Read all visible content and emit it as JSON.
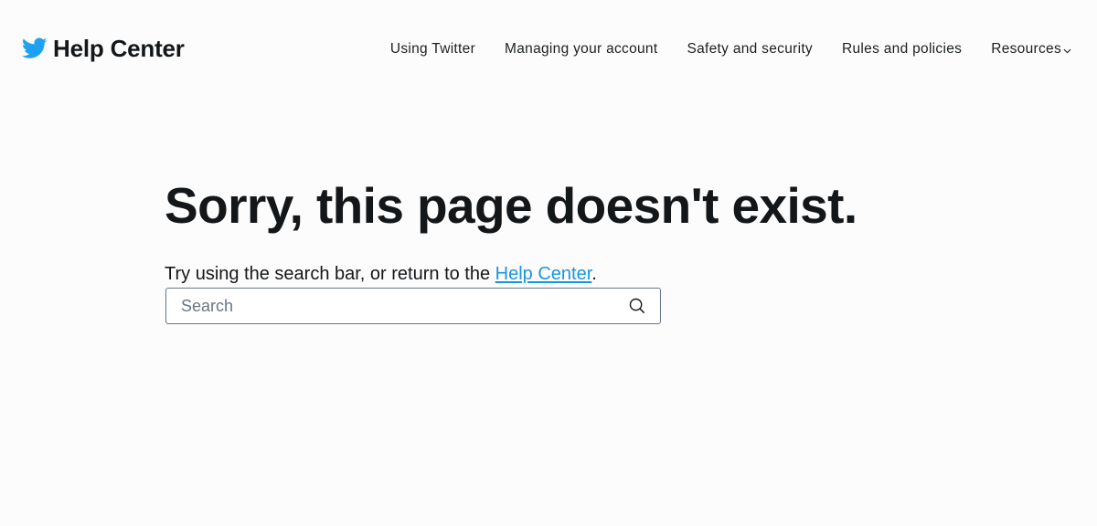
{
  "header": {
    "brand_title": "Help Center",
    "brand_icon": "twitter-bird-icon",
    "brand_color": "#1da1f2",
    "nav": [
      {
        "label": "Using Twitter"
      },
      {
        "label": "Managing your account"
      },
      {
        "label": "Safety and security"
      },
      {
        "label": "Rules and policies"
      },
      {
        "label": "Resources"
      }
    ]
  },
  "main": {
    "headline": "Sorry, this page doesn't exist.",
    "lead_prefix": "Try using the search bar, or return to the ",
    "lead_link": "Help Center",
    "lead_suffix": "."
  },
  "search": {
    "placeholder": "Search",
    "value": "",
    "icon": "search-icon"
  },
  "colors": {
    "link": "#1b95e0",
    "text": "#14171a",
    "border": "#657786"
  }
}
